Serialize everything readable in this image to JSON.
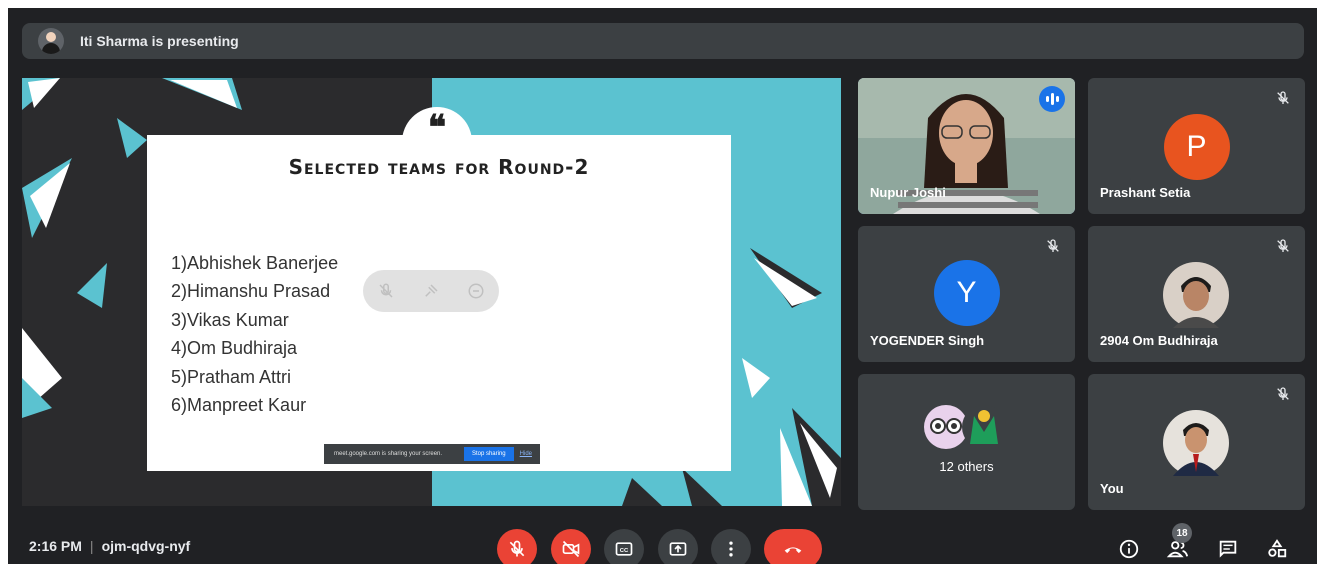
{
  "banner": {
    "text": "Iti Sharma is presenting"
  },
  "slide": {
    "title": "Selected teams for Round-2",
    "quote_mark": "❝",
    "teams": [
      "1)Abhishek Banerjee",
      "2)Himanshu Prasad",
      "3)Vikas Kumar",
      "4)Om Budhiraja",
      "5)Pratham Attri",
      "6)Manpreet Kaur"
    ],
    "share_bar": {
      "message": "meet.google.com is sharing your screen.",
      "stop_label": "Stop sharing",
      "hide_label": "Hide"
    }
  },
  "participants": [
    {
      "name": "Nupur Joshi",
      "speaking": true
    },
    {
      "name": "Prashant Setia",
      "initial": "P",
      "avatar_color": "#e8541f",
      "muted": true
    },
    {
      "name": "YOGENDER Singh",
      "initial": "Y",
      "avatar_color": "#1a73e8",
      "muted": true
    },
    {
      "name": "2904 Om Budhiraja",
      "muted": true
    },
    {
      "name": "12 others"
    },
    {
      "name": "You",
      "muted": true
    }
  ],
  "bottom": {
    "time": "2:16 PM",
    "meeting_code": "ojm-qdvg-nyf",
    "participant_count": "18"
  },
  "colors": {
    "background": "#202124",
    "tile": "#3c4043",
    "danger": "#ea4335",
    "accent": "#1a73e8",
    "teal": "#5bc2d0"
  }
}
